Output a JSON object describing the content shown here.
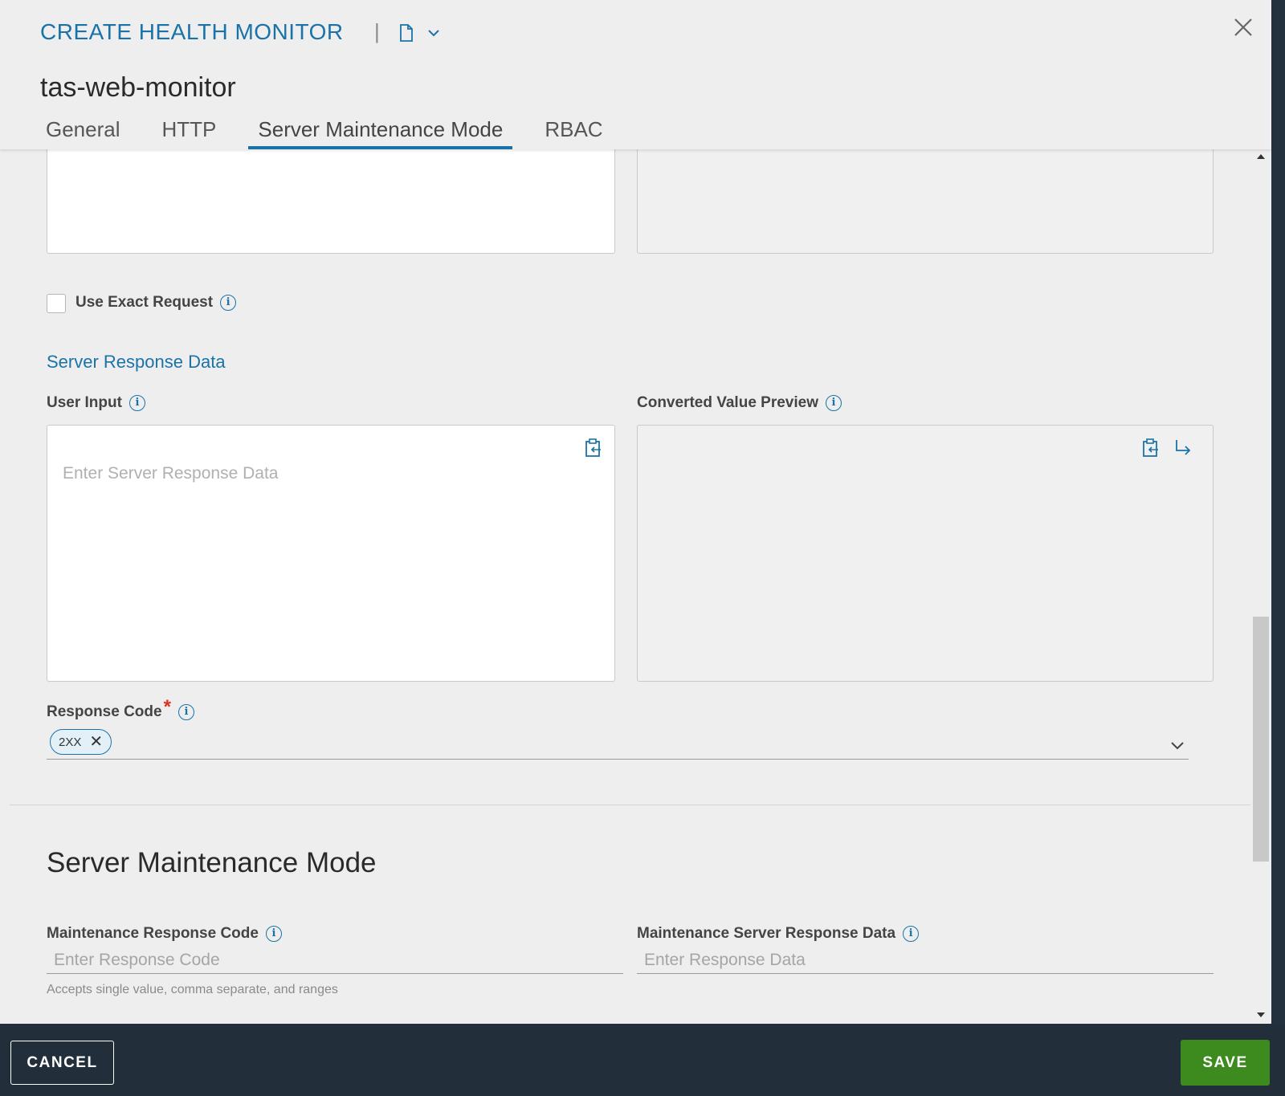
{
  "header": {
    "title": "CREATE HEALTH MONITOR",
    "separator": "|",
    "monitor_name": "tas-web-monitor",
    "doc_icon": "document-icon",
    "dropdown_icon": "chevron-down-icon",
    "close_icon": "close-icon"
  },
  "tabs": [
    {
      "label": "General",
      "active": false
    },
    {
      "label": "HTTP",
      "active": false
    },
    {
      "label": "Server Maintenance Mode",
      "active": true
    },
    {
      "label": "RBAC",
      "active": false
    }
  ],
  "form": {
    "use_exact_request": {
      "label": "Use Exact Request",
      "checked": false
    },
    "server_response_section": "Server Response Data",
    "user_input": {
      "label": "User Input",
      "placeholder": "Enter Server Response Data",
      "value": ""
    },
    "converted_preview": {
      "label": "Converted Value Preview"
    },
    "response_code": {
      "label": "Response Code",
      "required_mark": "*",
      "chips": [
        "2XX"
      ]
    }
  },
  "maintenance": {
    "title": "Server Maintenance Mode",
    "response_code": {
      "label": "Maintenance Response Code",
      "placeholder": "Enter Response Code",
      "helper": "Accepts single value, comma separate, and ranges"
    },
    "response_data": {
      "label": "Maintenance Server Response Data",
      "placeholder": "Enter Response Data"
    }
  },
  "footer": {
    "cancel_label": "CANCEL",
    "save_label": "SAVE"
  },
  "colors": {
    "accent": "#1a73a8",
    "save": "#3d8b1f",
    "footer_bg": "#222f3b",
    "required": "#d9341f"
  }
}
